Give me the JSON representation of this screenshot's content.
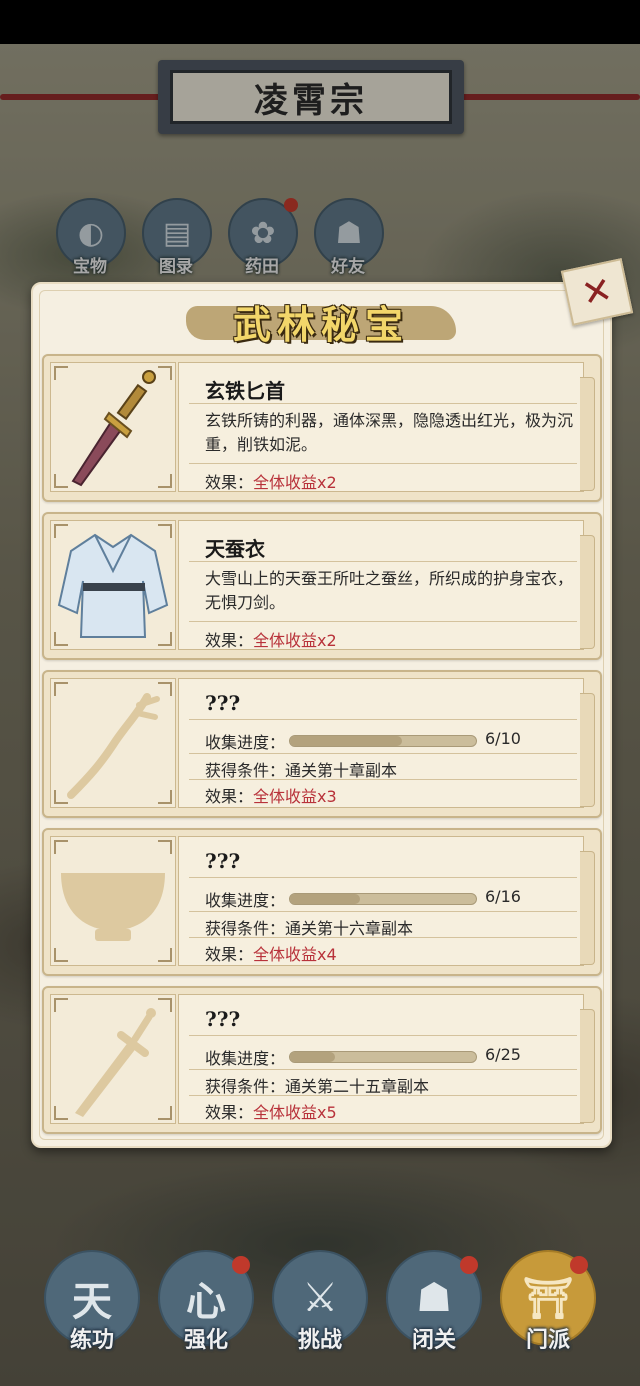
{
  "header": {
    "title": "凌霄宗"
  },
  "top_nav": [
    {
      "label": "宝物",
      "icon": "treasure-bag-icon",
      "glyph": "◐"
    },
    {
      "label": "图录",
      "icon": "scroll-icon",
      "glyph": "▤"
    },
    {
      "label": "药田",
      "icon": "flower-icon",
      "glyph": "✿"
    },
    {
      "label": "好友",
      "icon": "friends-icon",
      "glyph": "☗"
    }
  ],
  "panel": {
    "title": "武林秘宝",
    "close_glyph": "✕",
    "items": [
      {
        "name": "玄铁匕首",
        "icon": "dagger-icon",
        "description": "玄铁所铸的利器，通体深黑，隐隐透出红光，极为沉重，削铁如泥。",
        "effect_label": "效果：",
        "effect_value": "全体收益x2"
      },
      {
        "name": "天蚕衣",
        "icon": "silk-robe-icon",
        "description": "大雪山上的天蚕王所吐之蚕丝，所织成的护身宝衣，无惧刀剑。",
        "effect_label": "效果：",
        "effect_value": "全体收益x2"
      },
      {
        "name": "???",
        "icon": "locked-spear-icon",
        "progress_label": "收集进度：",
        "progress_text": "6/10",
        "progress": 0.6,
        "condition_label": "获得条件：",
        "condition_value": "通关第十章副本",
        "effect_label": "效果：",
        "effect_value": "全体收益x3"
      },
      {
        "name": "???",
        "icon": "locked-bowl-icon",
        "progress_label": "收集进度：",
        "progress_text": "6/16",
        "progress": 0.375,
        "condition_label": "获得条件：",
        "condition_value": "通关第十六章副本",
        "effect_label": "效果：",
        "effect_value": "全体收益x4"
      },
      {
        "name": "???",
        "icon": "locked-sword-icon",
        "progress_label": "收集进度：",
        "progress_text": "6/25",
        "progress": 0.24,
        "condition_label": "获得条件：",
        "condition_value": "通关第二十五章副本",
        "effect_label": "效果：",
        "effect_value": "全体收益x5"
      }
    ]
  },
  "bottom_nav": [
    {
      "label": "练功",
      "icon": "training-icon",
      "glyph": "天"
    },
    {
      "label": "强化",
      "icon": "heart-mind-icon",
      "glyph": "心"
    },
    {
      "label": "挑战",
      "icon": "crossed-swords-icon",
      "glyph": "⚔"
    },
    {
      "label": "闭关",
      "icon": "meditation-icon",
      "glyph": "☗"
    },
    {
      "label": "门派",
      "icon": "sect-gate-icon",
      "glyph": "⛩"
    }
  ],
  "colors": {
    "accent_red": "#b8323a",
    "panel_bg": "#f5efe1",
    "nav_blue": "#4f6879",
    "nav_active": "#c79a3a"
  }
}
